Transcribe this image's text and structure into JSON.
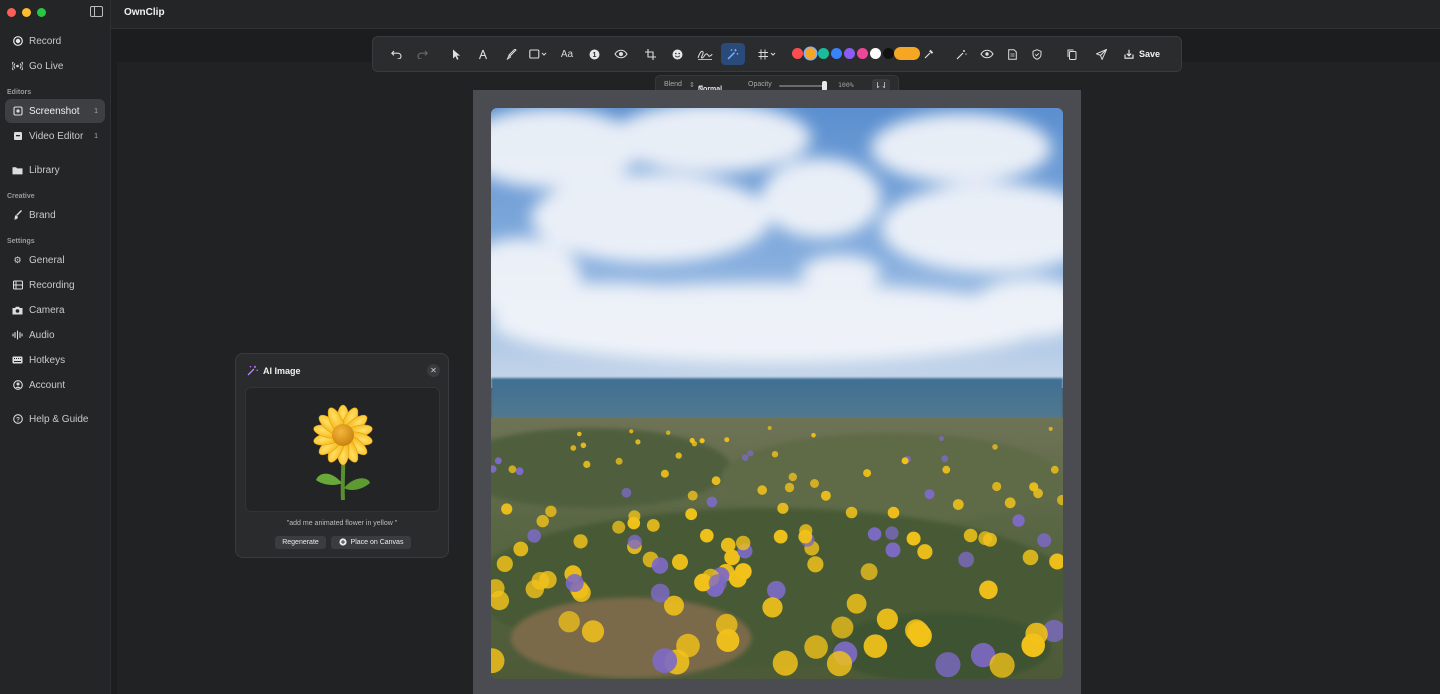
{
  "app": {
    "title": "OwnClip"
  },
  "sidebar": {
    "items_top": [
      {
        "label": "Record",
        "icon": "record-icon"
      },
      {
        "label": "Go Live",
        "icon": "broadcast-icon"
      }
    ],
    "section_editors": "Editors",
    "editors": [
      {
        "label": "Screenshot",
        "badge": "1",
        "icon": "screenshot-icon",
        "active": true
      },
      {
        "label": "Video Editor",
        "badge": "1",
        "icon": "video-editor-icon"
      },
      {
        "label": "Library",
        "icon": "folder-icon"
      }
    ],
    "section_creative": "Creative",
    "creative": [
      {
        "label": "Brand",
        "icon": "brush-icon"
      }
    ],
    "section_settings": "Settings",
    "settings": [
      {
        "label": "General",
        "icon": "gear-icon"
      },
      {
        "label": "Recording",
        "icon": "film-icon"
      },
      {
        "label": "Camera",
        "icon": "camera-icon"
      },
      {
        "label": "Audio",
        "icon": "waveform-icon"
      },
      {
        "label": "Hotkeys",
        "icon": "keyboard-icon"
      },
      {
        "label": "Account",
        "icon": "account-icon"
      }
    ],
    "help": {
      "label": "Help & Guide",
      "icon": "help-icon"
    }
  },
  "toolbar": {
    "text_tool": "Aa",
    "save_label": "Save",
    "colors": [
      "#ff4d4f",
      "#f5a623",
      "#1abc9c",
      "#3b82f6",
      "#8b5cf6",
      "#ec4899",
      "#ffffff",
      "#111111"
    ],
    "stroke_color": "#f5a623"
  },
  "subbar": {
    "blend_label": "Blend",
    "blend_value": "Normal",
    "opacity_label": "Opacity",
    "opacity_value": "100%",
    "opacity_fraction": 1.0
  },
  "ai_dialog": {
    "title": "AI Image",
    "prompt": "\"add me animated flower in yellow \"",
    "regenerate_label": "Regenerate",
    "place_label": "Place on Canvas"
  }
}
